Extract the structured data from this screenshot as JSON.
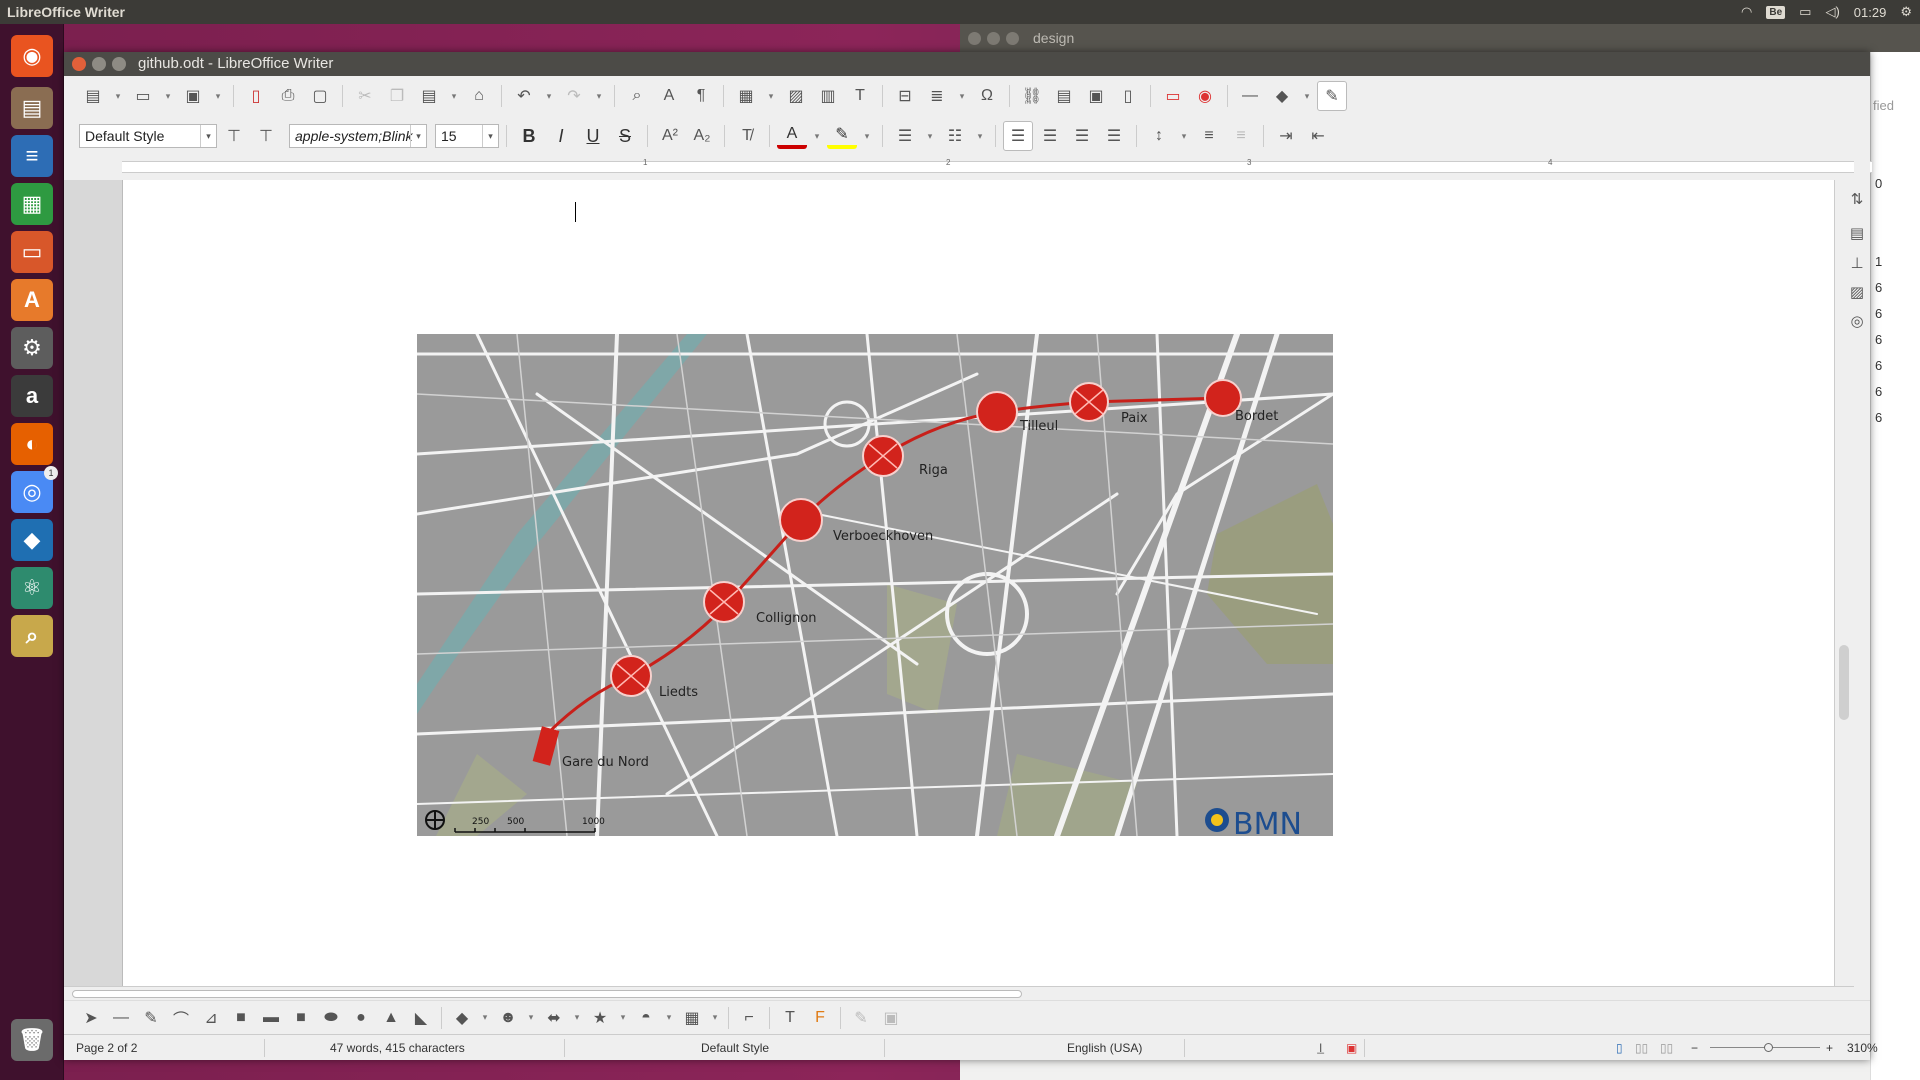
{
  "top_panel": {
    "app_title": "LibreOffice Writer",
    "keyboard_layout": "Be",
    "clock": "01:29"
  },
  "background_window": {
    "title": "design",
    "right_strip_texts": [
      "fied",
      "0",
      "1",
      "6",
      "6",
      "6",
      "6",
      "6",
      "6"
    ]
  },
  "launcher": {
    "items": [
      {
        "name": "ubuntu-dash-icon",
        "glyph": "◉",
        "color": "#e95420"
      },
      {
        "name": "files-icon",
        "glyph": "▤",
        "color": "#8a6d52"
      },
      {
        "name": "writer-icon",
        "glyph": "≡",
        "color": "#2d6db5"
      },
      {
        "name": "calc-icon",
        "glyph": "▦",
        "color": "#2e9a41"
      },
      {
        "name": "impress-icon",
        "glyph": "▭",
        "color": "#d8572a"
      },
      {
        "name": "software-center-icon",
        "glyph": "A",
        "color": "#e77a2b"
      },
      {
        "name": "system-settings-icon",
        "glyph": "⚙",
        "color": "#5d5d5d"
      },
      {
        "name": "amazon-icon",
        "glyph": "a",
        "color": "#3b3b3b"
      },
      {
        "name": "firefox-icon",
        "glyph": "◐",
        "color": "#e66000"
      },
      {
        "name": "chrome-icon",
        "glyph": "◎",
        "color": "#4a8af4"
      },
      {
        "name": "vscode-icon",
        "glyph": "◆",
        "color": "#1f6fb2"
      },
      {
        "name": "atom-icon",
        "glyph": "⚛",
        "color": "#2e8b6e"
      },
      {
        "name": "image-viewer-icon",
        "glyph": "⌕",
        "color": "#c8a84b"
      }
    ],
    "trash": {
      "name": "trash-icon",
      "glyph": "🗑"
    },
    "chrome_badge": "1"
  },
  "window": {
    "title": "github.odt - LibreOffice Writer"
  },
  "format_toolbar": {
    "paragraph_style": "Default Style",
    "font_name": "apple-system;Blink",
    "font_size": "15"
  },
  "ruler": {
    "numbers": [
      "1",
      "2",
      "3",
      "4"
    ]
  },
  "map": {
    "stations": [
      "Gare du Nord",
      "Liedts",
      "Collignon",
      "Verboeckhoven",
      "Riga",
      "Tilleul",
      "Paix",
      "Bordet"
    ],
    "scale_labels": [
      "250",
      "500",
      "1000"
    ],
    "logo_text": "BMN"
  },
  "status_bar": {
    "page": "Page 2 of 2",
    "words": "47 words, 415 characters",
    "page_style": "Default Style",
    "language": "English (USA)",
    "zoom": "310%"
  }
}
